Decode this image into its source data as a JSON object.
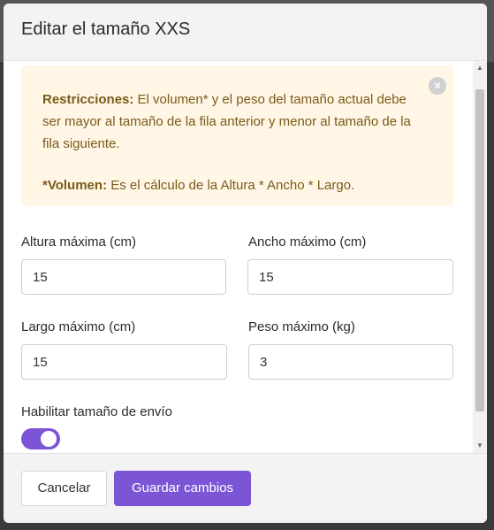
{
  "modal": {
    "title": "Editar el tamaño XXS"
  },
  "alert": {
    "restrictions_label": "Restricciones:",
    "restrictions_text": " El volumen* y el peso del tamaño actual debe ser mayor al tamaño de la fila anterior y menor al tamaño de la fila siguiente.",
    "volume_label": "*Volumen:",
    "volume_text": " Es el cálculo de la Altura * Ancho * Largo.",
    "close_glyph": "×"
  },
  "fields": {
    "height": {
      "label": "Altura máxima (cm)",
      "value": "15"
    },
    "width": {
      "label": "Ancho máximo (cm)",
      "value": "15"
    },
    "length": {
      "label": "Largo máximo (cm)",
      "value": "15"
    },
    "weight": {
      "label": "Peso máximo (kg)",
      "value": "3"
    }
  },
  "toggle": {
    "label": "Habilitar tamaño de envío",
    "enabled": true
  },
  "footer": {
    "cancel_label": "Cancelar",
    "save_label": "Guardar cambios"
  },
  "scrollbar": {
    "up_glyph": "▲",
    "down_glyph": "▼"
  },
  "colors": {
    "accent": "#7b55d6",
    "alert_bg": "#fff6e6",
    "alert_text": "#7a5a18"
  }
}
